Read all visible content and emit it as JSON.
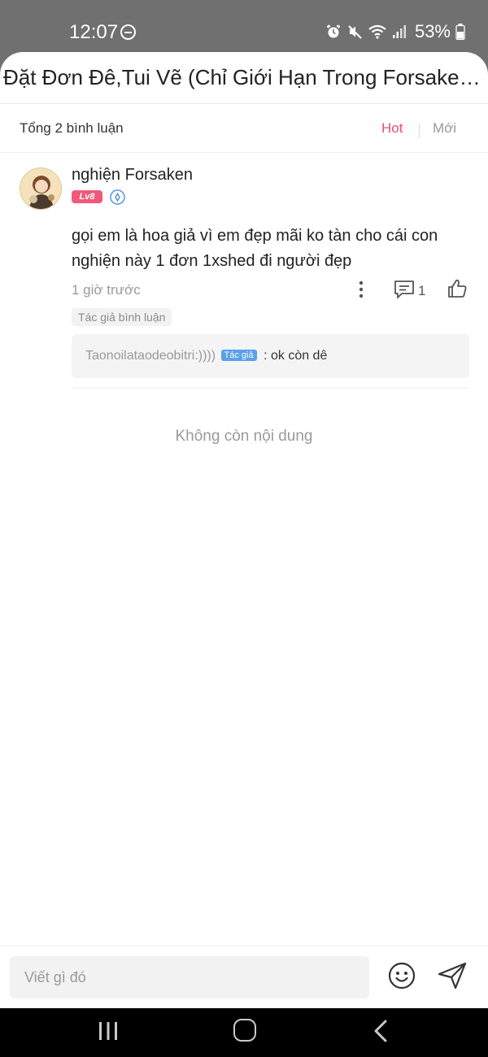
{
  "status_bar": {
    "time": "12:07",
    "battery": "53%"
  },
  "header": {
    "title": "Đặt Đơn Đê,Tui Vẽ (Chỉ Giới Hạn Trong Forsaken ..."
  },
  "comments_meta": {
    "count_label": "Tổng 2 bình luận",
    "sort_hot": "Hot",
    "sort_new": "Mới",
    "sort_active": "Hot",
    "accent_color": "#ee4d6a"
  },
  "comment": {
    "username": "nghiện Forsaken",
    "level_badge": "Lv8",
    "text": "gọi em là hoa giả vì em đẹp mãi ko tàn cho cái con nghiện này 1 đơn 1xshed đi người đẹp",
    "time": "1 giờ trước",
    "reply_count": "1",
    "author_tag": "Tác giả bình luận",
    "reply": {
      "user": "Taonoilataodeobitri:))))",
      "badge": "Tác giả",
      "separator": ":",
      "text": "ok còn dê"
    }
  },
  "footer": {
    "end_text": "Không còn nội dung",
    "input_placeholder": "Viết gì đó"
  }
}
